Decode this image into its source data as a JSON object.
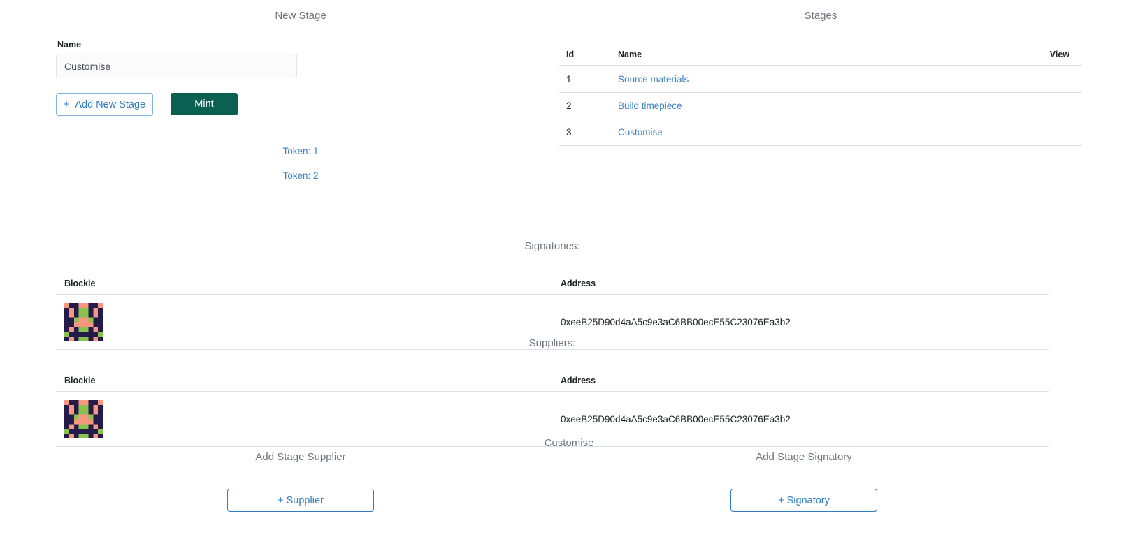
{
  "new_stage": {
    "title": "New Stage",
    "name_label": "Name",
    "name_value": "Customise",
    "name_placeholder": "",
    "add_button": "Add New Stage",
    "add_button_icon": "plus-icon",
    "mint_button": "Mint"
  },
  "tokens": [
    {
      "label": "Token: 1"
    },
    {
      "label": "Token: 2"
    }
  ],
  "stages": {
    "title": "Stages",
    "columns": [
      "Id",
      "Name",
      "View"
    ],
    "rows": [
      {
        "id": "1",
        "name": "Source materials",
        "view": ""
      },
      {
        "id": "2",
        "name": "Build timepiece",
        "view": ""
      },
      {
        "id": "3",
        "name": "Customise",
        "view": ""
      }
    ]
  },
  "signatories": {
    "title": "Signatories:",
    "columns": [
      "Blockie",
      "Address"
    ],
    "rows": [
      {
        "blockie": "blockie-identicon",
        "address": "0xeeB25D90d4aA5c9e3aC6BB00ecE55C23076Ea3b2"
      }
    ]
  },
  "suppliers": {
    "title": "Suppliers:",
    "columns": [
      "Blockie",
      "Address"
    ],
    "rows": [
      {
        "blockie": "blockie-identicon",
        "address": "0xeeB25D90d4aA5c9e3aC6BB00ecE55C23076Ea3b2"
      }
    ]
  },
  "bottom": {
    "stage_name": "Customise",
    "supplier_panel": {
      "heading": "Add Stage Supplier",
      "button": "+ Supplier"
    },
    "signatory_panel": {
      "heading": "Add Stage Signatory",
      "button": "+ Signatory"
    }
  },
  "colors": {
    "link": "#3b82c4",
    "mint_bg": "#0a6152",
    "outline_blue": "#2f7cc0",
    "muted_text": "#6c757d",
    "border": "#dee2e6"
  }
}
